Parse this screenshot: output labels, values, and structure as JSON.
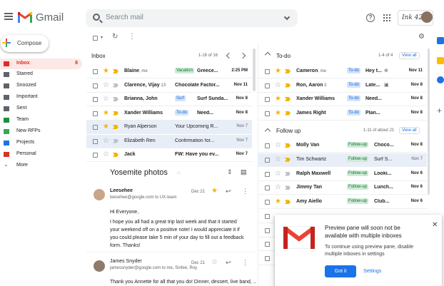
{
  "app": {
    "name": "Gmail",
    "brand": "Ink 42"
  },
  "search": {
    "placeholder": "Search mail"
  },
  "sidebar": {
    "compose": "Compose",
    "items": [
      {
        "label": "Inbox",
        "count": "8",
        "color": "#d93025"
      },
      {
        "label": "Starred",
        "count": "",
        "color": "#5f6368"
      },
      {
        "label": "Snoozed",
        "count": "",
        "color": "#5f6368"
      },
      {
        "label": "Important",
        "count": "",
        "color": "#5f6368"
      },
      {
        "label": "Sent",
        "count": "",
        "color": "#5f6368"
      },
      {
        "label": "Team",
        "count": "",
        "color": "#1e8e3e"
      },
      {
        "label": "New RFPs",
        "count": "",
        "color": "#34a853"
      },
      {
        "label": "Projects",
        "count": "",
        "color": "#1a73e8"
      },
      {
        "label": "Personal",
        "count": "",
        "color": "#d93025"
      },
      {
        "label": "More",
        "count": "",
        "color": "#5f6368"
      }
    ]
  },
  "inbox": {
    "title": "Inbox",
    "range": "1-16 of 16",
    "rows": [
      {
        "sender": "Blaine",
        "extra": ", me",
        "tag": "Vacation",
        "tagType": "vac",
        "subject": "Greece...",
        "date": "2:25 PM",
        "starred": true,
        "important": true,
        "unread": true,
        "selected": false
      },
      {
        "sender": "Clarence, Vijay",
        "extra": " 13",
        "tag": "",
        "tagType": "",
        "subject": "Chocolate Factor...",
        "date": "Nov 11",
        "starred": false,
        "important": false,
        "unread": true,
        "selected": false
      },
      {
        "sender": "Brianna, John",
        "extra": "",
        "tag": "Surf",
        "tagType": "surf",
        "subject": "Surf Sunda...",
        "date": "Nov 8",
        "starred": false,
        "important": false,
        "unread": true,
        "selected": false
      },
      {
        "sender": "Xander Williams",
        "extra": "",
        "tag": "To-do",
        "tagType": "todo",
        "subject": "Need...",
        "date": "Nov 8",
        "starred": true,
        "important": true,
        "unread": true,
        "selected": false
      },
      {
        "sender": "Ryan Alperson",
        "extra": "",
        "tag": "",
        "tagType": "",
        "subject": "Your Upcoming R...",
        "date": "Nov 7",
        "starred": true,
        "important": true,
        "unread": false,
        "selected": true
      },
      {
        "sender": "Elizabeth Ren",
        "extra": "",
        "tag": "",
        "tagType": "",
        "subject": "Confirmation for...",
        "date": "Nov 7",
        "starred": false,
        "important": false,
        "unread": false,
        "selected": true
      },
      {
        "sender": "Jack",
        "extra": "",
        "tag": "",
        "tagType": "",
        "subject": "FW: Have you ev...",
        "date": "Nov 7",
        "starred": false,
        "important": true,
        "unread": true,
        "selected": false
      }
    ]
  },
  "todo": {
    "title": "To-do",
    "range": "1-4 of 4",
    "viewall": "View all",
    "rows": [
      {
        "sender": "Cameron",
        "extra": ", me",
        "tag": "To-do",
        "subject": "Hey t...",
        "date": "Nov 11",
        "icon": "⊕",
        "starred": true,
        "important": true,
        "unread": true
      },
      {
        "sender": "Ron, Aaron",
        "extra": " 3",
        "tag": "To-do",
        "subject": "Late...",
        "date": "Nov 8",
        "icon": "▣",
        "starred": false,
        "important": true,
        "unread": true
      },
      {
        "sender": "Xander Williams",
        "extra": "",
        "tag": "To-do",
        "subject": "Need...",
        "date": "Nov 8",
        "icon": "",
        "starred": true,
        "important": true,
        "unread": true
      },
      {
        "sender": "James Right",
        "extra": "",
        "tag": "To-do",
        "subject": "Plan...",
        "date": "Nov 8",
        "icon": "",
        "starred": true,
        "important": true,
        "unread": true
      }
    ]
  },
  "followup": {
    "title": "Follow up",
    "range": "1-11 of about 21",
    "viewall": "View all",
    "rows": [
      {
        "sender": "Molly Van",
        "tag": "Follow-up",
        "subject": "Choco...",
        "date": "Nov 8",
        "starred": false,
        "important": true,
        "unread": true,
        "selected": false
      },
      {
        "sender": "Tim Schwartz",
        "tag": "Follow-up",
        "subject": "Surf S...",
        "date": "Nov 7",
        "starred": false,
        "important": true,
        "unread": false,
        "selected": true
      },
      {
        "sender": "Ralph Maxwell",
        "tag": "Follow-up",
        "subject": "Looki...",
        "date": "Nov 6",
        "starred": false,
        "important": false,
        "unread": true,
        "selected": false
      },
      {
        "sender": "Jimmy Tan",
        "tag": "Follow-up",
        "subject": "Lunch...",
        "date": "Nov 6",
        "starred": false,
        "important": false,
        "unread": true,
        "selected": false
      },
      {
        "sender": "Amy Aiello",
        "tag": "Follow-up",
        "subject": "Club...",
        "date": "Nov 6",
        "starred": true,
        "important": true,
        "unread": true,
        "selected": false
      }
    ]
  },
  "reading": {
    "title": "Yosemite photos",
    "msg1": {
      "name": "Leesehee",
      "email": "leesehee@google.com to UX-team",
      "date": "Dec 21",
      "body": [
        "Hi Everyone,",
        "I hope you all had a great trip last week and that it started",
        "your weekend off on a positive note! I would appreciate it if",
        "you could please take 5 min of your day to fill out a feedback",
        "form. Thanks!"
      ]
    },
    "msg2": {
      "name": "James Snyder",
      "email": "jamessnyder@google.com to me, Sinfee, Roy",
      "date": "Dec 21",
      "body": "Thank you Annette for all that you do! Dinner, dessert, live band, ..."
    }
  },
  "toast": {
    "title1": "Preview pane will soon not be",
    "title2": "available with multiple inboxes",
    "body1": "To continue using preview pane, disable",
    "body2": "multiple inboxes in settings",
    "primary": "Got it",
    "secondary": "Settings"
  }
}
